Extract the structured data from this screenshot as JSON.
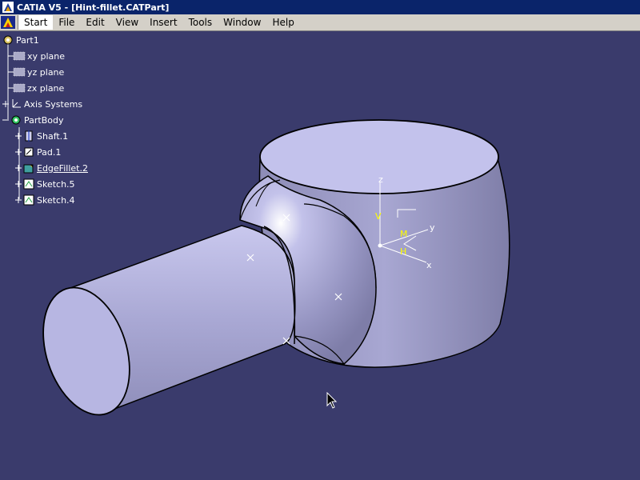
{
  "window": {
    "title": "CATIA V5 - [Hint-fillet.CATPart]"
  },
  "menu": {
    "items": [
      "Start",
      "File",
      "Edit",
      "View",
      "Insert",
      "Tools",
      "Window",
      "Help"
    ]
  },
  "tree": {
    "root": "Part1",
    "planes": [
      "xy plane",
      "yz plane",
      "zx plane"
    ],
    "axis_systems": "Axis Systems",
    "body": "PartBody",
    "features": [
      "Shaft.1",
      "Pad.1",
      "EdgeFillet.2",
      "Sketch.5",
      "Sketch.4"
    ]
  },
  "compass": {
    "z": "z",
    "y": "y",
    "x": "x",
    "v": "V",
    "h": "H",
    "m": "M"
  },
  "colors": {
    "background": "#3a3b6c",
    "part": "#b9b8e0",
    "axis": "#ffff00"
  }
}
